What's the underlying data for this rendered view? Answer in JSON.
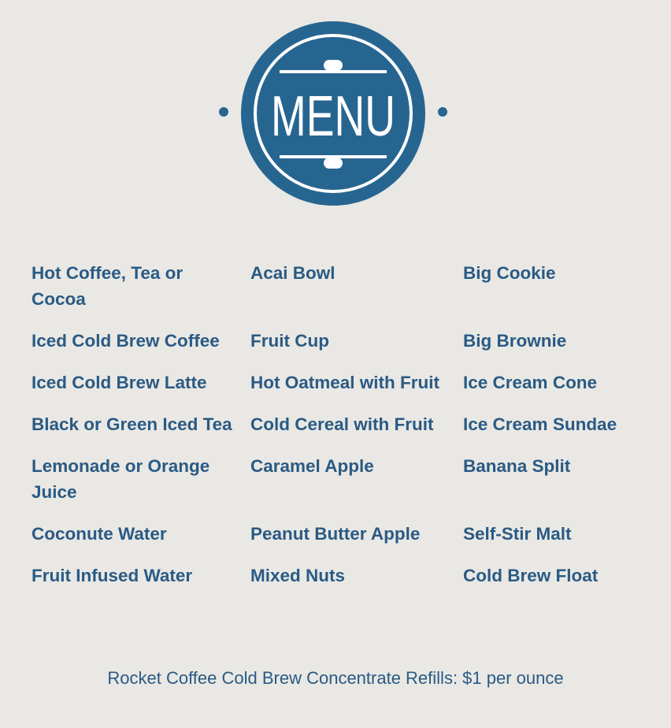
{
  "logo": {
    "text": "MENU",
    "color": "#276591"
  },
  "menu": {
    "rows": [
      [
        "Hot Coffee, Tea or Cocoa",
        "Acai Bowl",
        "Big Cookie"
      ],
      [
        "Iced Cold Brew Coffee",
        "Fruit Cup",
        "Big Brownie"
      ],
      [
        "Iced Cold Brew Latte",
        "Hot Oatmeal with Fruit",
        "Ice Cream Cone"
      ],
      [
        "Black or Green Iced Tea",
        "Cold Cereal with Fruit",
        "Ice Cream Sundae"
      ],
      [
        "Lemonade or Orange Juice",
        "Caramel Apple",
        "Banana Split"
      ],
      [
        "Coconute Water",
        "Peanut Butter Apple",
        "Self-Stir Malt"
      ],
      [
        "Fruit Infused Water",
        "Mixed Nuts",
        "Cold Brew Float"
      ]
    ]
  },
  "footer": {
    "text": "Rocket Coffee Cold Brew Concentrate Refills: $1 per ounce"
  }
}
